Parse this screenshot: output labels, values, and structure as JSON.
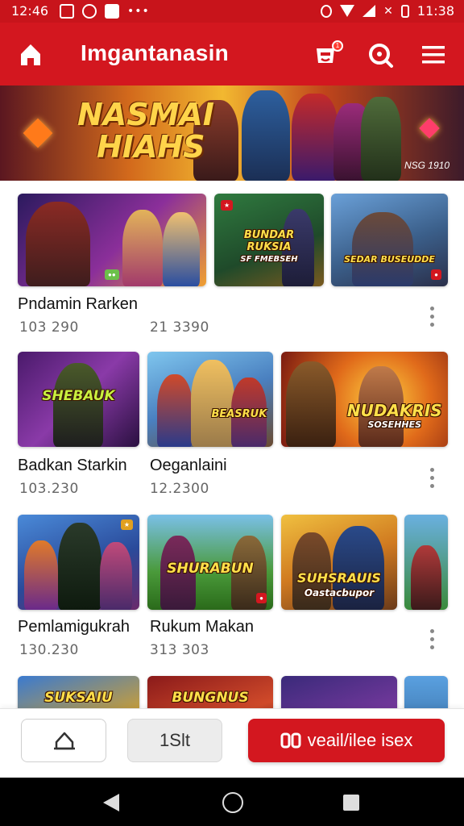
{
  "status_bar": {
    "time": "12:46",
    "right_time": "11:38"
  },
  "app_bar": {
    "title": "Imgantanasin",
    "bag_badge": "1"
  },
  "banner": {
    "title_line1": "NASMAI",
    "title_line2": "HIAHS",
    "subtitle": "NSG 1910"
  },
  "tiles": [
    {
      "label": "",
      "sub": ""
    },
    {
      "label": "BUNDAR RUKSIA",
      "sub": "SF FMEBSEH"
    },
    {
      "label": "SEDAR BUSEUDDE",
      "sub": ""
    },
    {
      "label": "SHEBAUK",
      "sub": ""
    },
    {
      "label": "BEASRUK",
      "sub": ""
    },
    {
      "label": "NUDAKRIS",
      "sub": "SOSEHHES"
    },
    {
      "label": "",
      "sub": ""
    },
    {
      "label": "SHURABUN",
      "sub": ""
    },
    {
      "label": "SUHSRAUIS",
      "sub": "Oastacbupor"
    },
    {
      "label": "",
      "sub": ""
    },
    {
      "label": "SUKSAIU",
      "sub": ""
    },
    {
      "label": "BUNGNUS",
      "sub": ""
    },
    {
      "label": "",
      "sub": ""
    }
  ],
  "rows": [
    {
      "left_title": "Pndamin Rarken",
      "left_count": "103 290",
      "right_title": "",
      "right_count": "21 3390"
    },
    {
      "left_title": "Badkan Starkin",
      "left_count": "103.230",
      "right_title": "Oeganlaini",
      "right_count": "12.2300"
    },
    {
      "left_title": "Pemlamigukrah",
      "left_count": "130.230",
      "right_title": "Rukum Makan",
      "right_count": "313 303"
    }
  ],
  "action_bar": {
    "middle_label": "1Slt",
    "primary_label": "veail/ilee isex"
  },
  "icons": {
    "home": "home-icon",
    "bag": "bag-icon",
    "search": "search-icon",
    "menu": "menu-icon",
    "share": "share-icon",
    "primary": "play-icon"
  },
  "colors": {
    "brand_red": "#d3171f",
    "status_red": "#c8141b"
  }
}
